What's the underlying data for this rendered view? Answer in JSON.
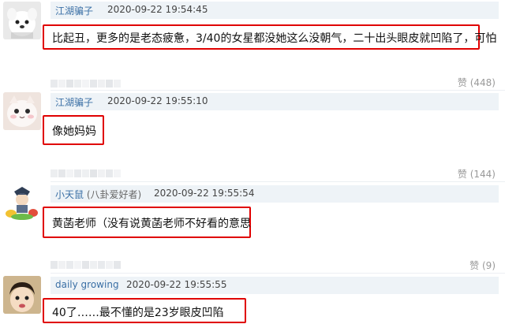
{
  "like_label": "赞",
  "comments": [
    {
      "username": "江湖骗子",
      "tag": "",
      "time": "2020-09-22 19:54:45",
      "text": "比起丑，更多的是老态疲惫，3/40的女星都没她这么没朝气，二十出头眼皮就凹陷了，可怕",
      "likes": "(448)",
      "avatar": "white-dog-avatar"
    },
    {
      "username": "江湖骗子",
      "tag": "",
      "time": "2020-09-22 19:55:10",
      "text": "像她妈妈",
      "likes": "(144)",
      "avatar": "white-cat-avatar"
    },
    {
      "username": "小天鼠",
      "tag": "(八卦爱好者)",
      "time": "2020-09-22 19:55:54",
      "text": "黄菡老师（没有说黄菡老师不好看的意思",
      "likes": "(9)",
      "avatar": "cartoon-character-avatar"
    },
    {
      "username": "daily growing",
      "tag": "",
      "time": "2020-09-22 19:55:55",
      "text": "40了……最不懂的是23岁眼皮凹陷",
      "likes": "",
      "avatar": "child-avatar"
    }
  ]
}
